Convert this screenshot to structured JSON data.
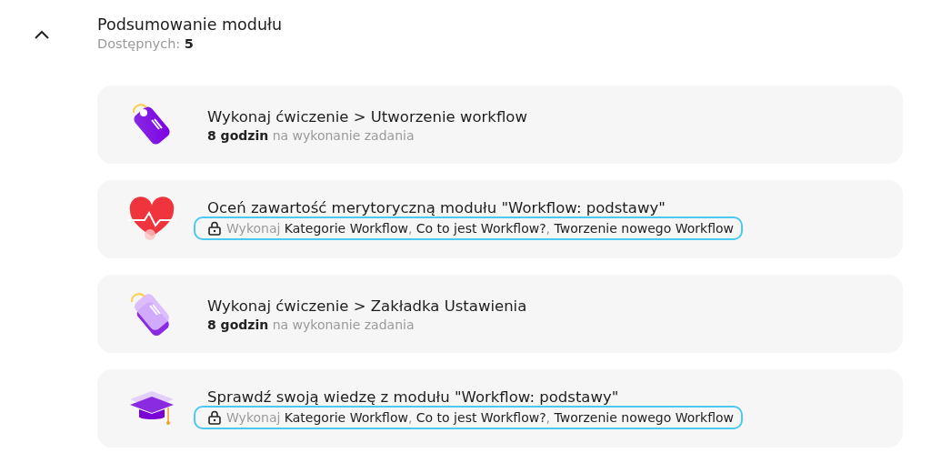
{
  "header": {
    "title": "Podsumowanie modułu",
    "available_label": "Dostępnych:",
    "available_count": "5",
    "expanded": true
  },
  "items": [
    {
      "kind": "task",
      "title": "Wykonaj ćwiczenie > Utworzenie workflow",
      "duration": "8 godzin",
      "duration_note": "na wykonanie zadania"
    },
    {
      "kind": "locked",
      "title": "Oceń zawartość merytoryczną modułu \"Workflow: podstawy\"",
      "prefix": "Wykonaj",
      "separator": ",",
      "requirements": [
        "Kategorie Workflow",
        "Co to jest Workflow?",
        "Tworzenie nowego Workflow"
      ]
    },
    {
      "kind": "task",
      "title": "Wykonaj ćwiczenie > Zakładka Ustawienia",
      "duration": "8 godzin",
      "duration_note": "na wykonanie zadania"
    },
    {
      "kind": "locked",
      "title": "Sprawdź swoją wiedzę z modułu \"Workflow: podstawy\"",
      "prefix": "Wykonaj",
      "separator": ",",
      "requirements": [
        "Kategorie Workflow",
        "Co to jest Workflow?",
        "Tworzenie nowego Workflow"
      ]
    }
  ]
}
